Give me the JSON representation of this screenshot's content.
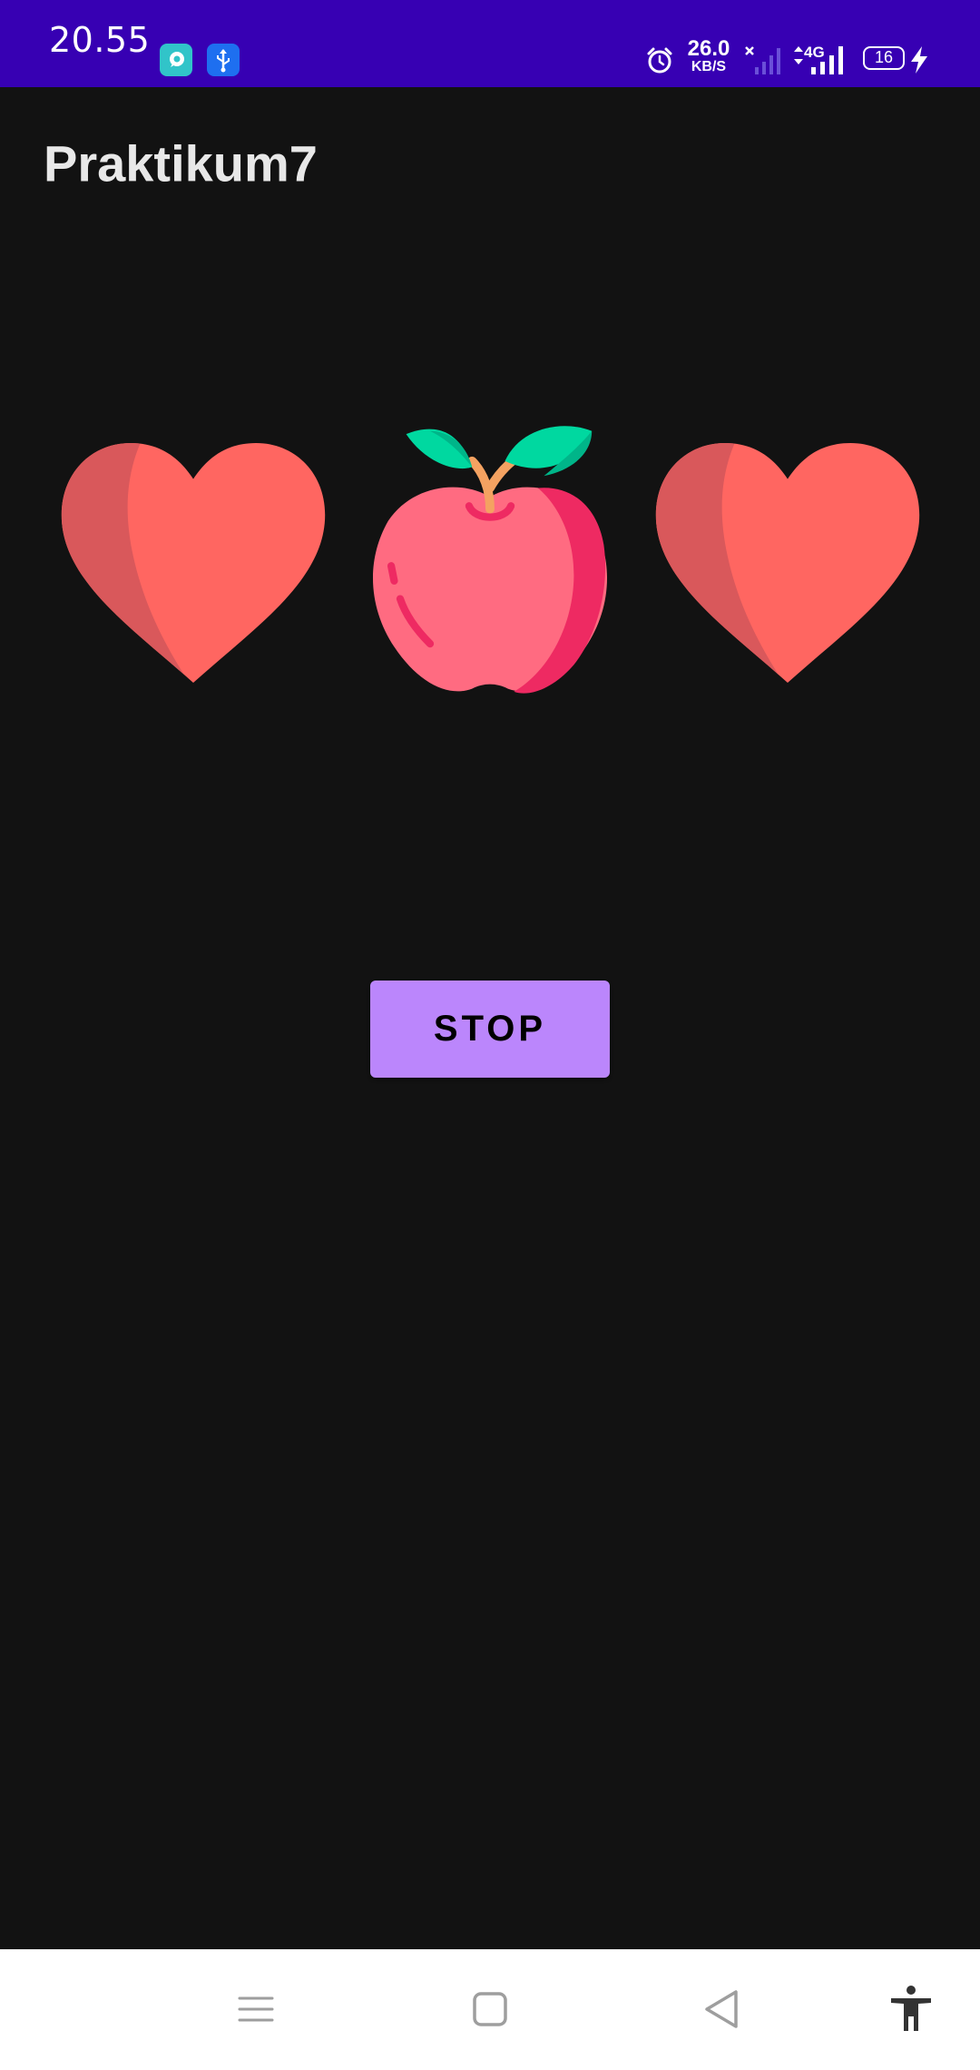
{
  "status_bar": {
    "time": "20.55",
    "net_speed_value": "26.0",
    "net_speed_unit": "KB/S",
    "network_type": "4G",
    "battery_level": "16",
    "icons": [
      "app-notification-icon",
      "usb-icon",
      "alarm-icon",
      "no-signal-icon",
      "signal-icon",
      "battery-icon",
      "charging-icon"
    ]
  },
  "app_bar": {
    "title": "Praktikum7"
  },
  "slots": [
    {
      "icon": "heart-icon"
    },
    {
      "icon": "apple-icon"
    },
    {
      "icon": "heart-icon"
    }
  ],
  "controls": {
    "stop_label": "STOP"
  },
  "nav_bar": {
    "icons": [
      "recents-icon",
      "home-icon",
      "back-icon",
      "accessibility-icon"
    ]
  },
  "colors": {
    "status_bar": "#3700b3",
    "background": "#121212",
    "button": "#bb86fc",
    "heart": "#ff6661",
    "apple": "#ff6b81",
    "leaf": "#00d8a0"
  }
}
